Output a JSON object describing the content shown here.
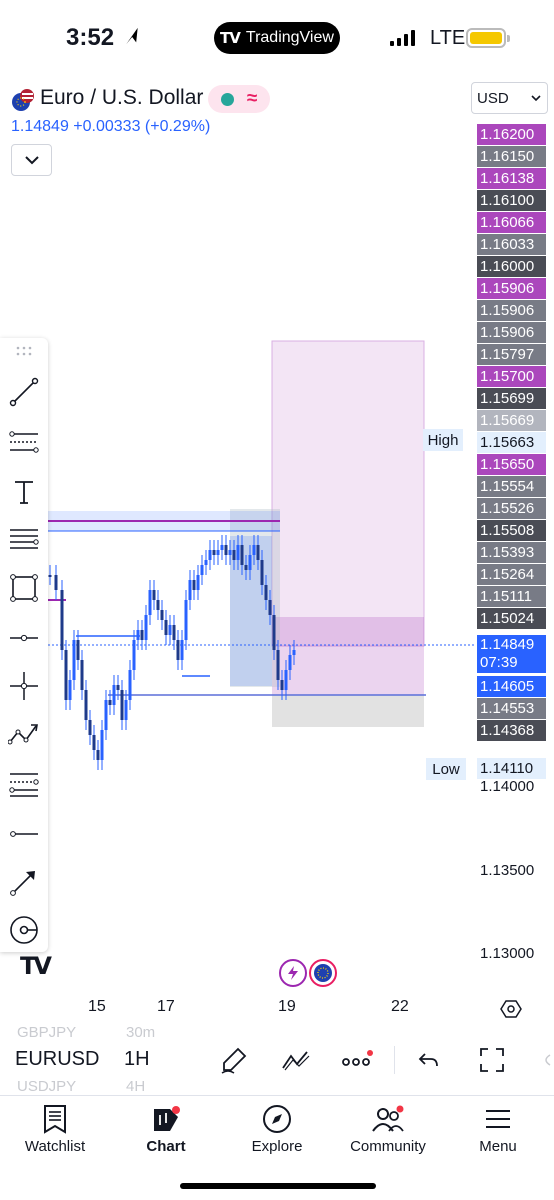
{
  "status_bar": {
    "time": "3:52",
    "app_pill": "TradingView",
    "network": "LTE",
    "battery_color": "#f5c800"
  },
  "header": {
    "symbol_title": "Euro / U.S. Dollar",
    "price": "1.14849",
    "change": "+0.00333",
    "change_pct": "(+0.29%)",
    "price_line": "1.14849 +0.00333 (+0.29%)",
    "currency": "USD",
    "badge_wave": "≈"
  },
  "price_scale": {
    "labels": [
      {
        "text": "1.16200",
        "style": "purple"
      },
      {
        "text": "1.16150",
        "style": "gray"
      },
      {
        "text": "1.16138",
        "style": "purple"
      },
      {
        "text": "1.16100",
        "style": "dark"
      },
      {
        "text": "1.16066",
        "style": "purple"
      },
      {
        "text": "1.16033",
        "style": "gray"
      },
      {
        "text": "1.16000",
        "style": "dark"
      },
      {
        "text": "1.15906",
        "style": "purple"
      },
      {
        "text": "1.15906",
        "style": "gray"
      },
      {
        "text": "1.15906",
        "style": "gray"
      },
      {
        "text": "1.15797",
        "style": "gray"
      },
      {
        "text": "1.15700",
        "style": "purple"
      },
      {
        "text": "1.15699",
        "style": "dark"
      },
      {
        "text": "1.15669",
        "style": "light"
      },
      {
        "text": "1.15663",
        "style": "highlight"
      },
      {
        "text": "1.15650",
        "style": "purple"
      },
      {
        "text": "1.15554",
        "style": "gray"
      },
      {
        "text": "1.15526",
        "style": "gray"
      },
      {
        "text": "1.15508",
        "style": "dark"
      },
      {
        "text": "1.15393",
        "style": "gray"
      },
      {
        "text": "1.15264",
        "style": "gray"
      },
      {
        "text": "1.15111",
        "style": "gray"
      },
      {
        "text": "1.15024",
        "style": "dark"
      }
    ],
    "current": {
      "price": "1.14849",
      "countdown": "07:39"
    },
    "below": [
      {
        "text": "1.14605",
        "style": "blue"
      },
      {
        "text": "1.14553",
        "style": "gray"
      },
      {
        "text": "1.14368",
        "style": "dark"
      }
    ],
    "low_value": "1.14110",
    "axis_ticks": [
      "1.14000",
      "1.13500",
      "1.13000"
    ],
    "high_tag": "High",
    "low_tag": "Low"
  },
  "time_axis": [
    "15",
    "17",
    "19",
    "22"
  ],
  "symbol_bar": {
    "ghost_prev_symbol": "GBPJPY",
    "ghost_prev_tf": "30m",
    "symbol": "EURUSD",
    "timeframe": "1H",
    "ghost_next_symbol": "USDJPY",
    "ghost_next_tf": "4H"
  },
  "tabs": [
    {
      "label": "Watchlist",
      "icon": "watchlist-icon"
    },
    {
      "label": "Chart",
      "icon": "chart-icon"
    },
    {
      "label": "Explore",
      "icon": "compass-icon"
    },
    {
      "label": "Community",
      "icon": "community-icon"
    },
    {
      "label": "Menu",
      "icon": "menu-icon"
    }
  ],
  "colors": {
    "accent": "#2962ff",
    "purple_zone": "#9c27b0",
    "candles": "#2962ff"
  }
}
